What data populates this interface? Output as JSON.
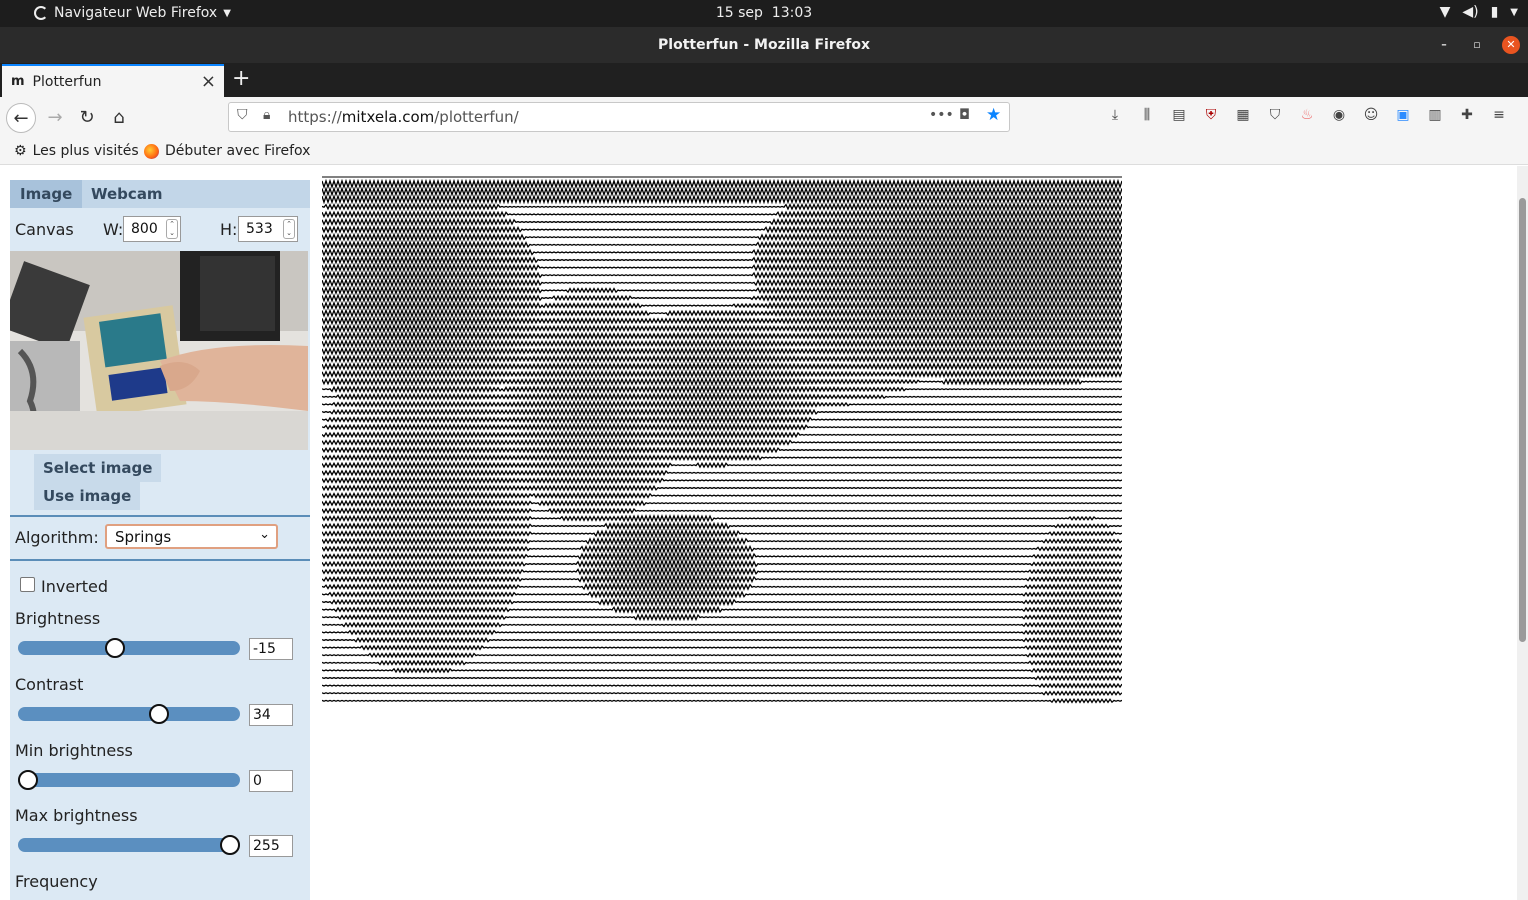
{
  "system": {
    "app_menu": "Navigateur Web Firefox",
    "date": "15 sep",
    "time": "13:03"
  },
  "window": {
    "title": "Plotterfun - Mozilla Firefox"
  },
  "tab": {
    "favicon": "m",
    "title": "Plotterfun",
    "close": "×",
    "new_tab": "+"
  },
  "navigation": {
    "url_prefix": "https://",
    "url_host": "mitxela.com",
    "url_path": "/plotterfun/",
    "page_actions": "•••"
  },
  "bookmarks": {
    "most_visited": "Les plus visités",
    "getting_started": "Débuter avec Firefox"
  },
  "panel": {
    "tabs": [
      "Image",
      "Webcam"
    ],
    "canvas_label": "Canvas",
    "width_label": "W:",
    "width_value": "800",
    "height_label": "H:",
    "height_value": "533",
    "select_image": "Select image",
    "use_image": "Use image",
    "algorithm_label": "Algorithm:",
    "algorithm_value": "Springs",
    "inverted_label": "Inverted",
    "inverted_checked": false,
    "brightness_label": "Brightness",
    "brightness_value": "-15",
    "contrast_label": "Contrast",
    "contrast_value": "34",
    "min_brightness_label": "Min brightness",
    "min_brightness_value": "0",
    "max_brightness_label": "Max brightness",
    "max_brightness_value": "255",
    "frequency_label": "Frequency"
  },
  "sliders": {
    "brightness": 0.43,
    "contrast": 0.65,
    "min_brightness": 0.0,
    "max_brightness": 1.0
  },
  "colors": {
    "accent": "#0a84ff",
    "panel_bg": "#dce9f4",
    "slider_track": "#5b8fc0",
    "close_button": "#e95420"
  }
}
